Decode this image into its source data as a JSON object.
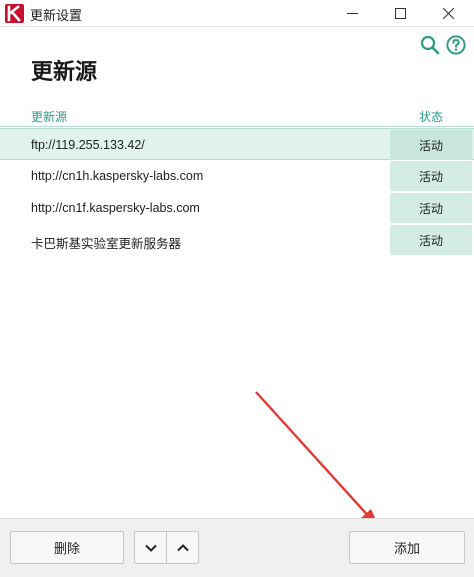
{
  "window": {
    "title": "更新设置",
    "controls": {
      "minimize": "—",
      "maximize": "☐",
      "close": "✕"
    }
  },
  "header": {
    "page_title": "更新源",
    "icons": [
      "search-icon",
      "help-icon"
    ]
  },
  "table": {
    "columns": {
      "source": "更新源",
      "status": "状态"
    },
    "rows": [
      {
        "source": "ftp://119.255.133.42/",
        "status": "活动",
        "selected": true
      },
      {
        "source": "http://cn1h.kaspersky-labs.com",
        "status": "活动",
        "selected": false
      },
      {
        "source": "http://cn1f.kaspersky-labs.com",
        "status": "活动",
        "selected": false
      },
      {
        "source": "卡巴斯基实验室更新服务器",
        "status": "活动",
        "selected": false
      }
    ]
  },
  "footer": {
    "delete_label": "删除",
    "move_down_glyph": "⌄",
    "move_up_glyph": "⌃",
    "add_label": "添加"
  },
  "colors": {
    "accent": "#2f9b85",
    "selected_row": "#dff2ed",
    "status_cell": "#d4ece6",
    "annotation_arrow": "#e53935",
    "brand": "#c8102e"
  }
}
